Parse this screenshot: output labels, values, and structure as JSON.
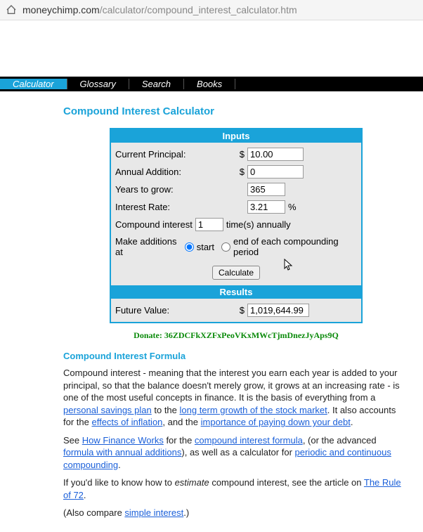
{
  "url": {
    "domain": "moneychimp.com",
    "path": "/calculator/compound_interest_calculator.htm"
  },
  "nav": {
    "items": [
      "Calculator",
      "Glossary",
      "Search",
      "Books"
    ]
  },
  "page": {
    "title": "Compound Interest Calculator",
    "inputs_header": "Inputs",
    "results_header": "Results",
    "labels": {
      "principal": "Current Principal:",
      "addition": "Annual Addition:",
      "years": "Years to grow:",
      "rate": "Interest Rate:",
      "compound_prefix": "Compound interest",
      "compound_suffix": "time(s) annually",
      "additions_at": "Make additions at",
      "start": "start",
      "end": "end of each compounding period",
      "calculate": "Calculate",
      "future_value": "Future Value:",
      "percent": "%",
      "dollar": "$"
    },
    "values": {
      "principal": "10.00",
      "addition": "0",
      "years": "365",
      "rate": "3.21",
      "times": "1",
      "future_value": "1,019,644.99"
    }
  },
  "donate": "Donate: 36ZDCFkXZFxPeoVKxMWcTjmDnezJyAps9Q",
  "article": {
    "heading": "Compound Interest Formula",
    "p1": "Compound interest - meaning that the interest you earn each year is added to your principal, so that the balance doesn't merely grow, it grows at an increasing rate - is one of the most useful concepts in finance. It is the basis of everything from a ",
    "link1": "personal savings plan",
    "p1b": " to the ",
    "link2": "long term growth of the stock market",
    "p1c": ". It also accounts for the ",
    "link3": "effects of inflation",
    "p1d": ", and the ",
    "link4": "importance of paying down your debt",
    "p1e": ".",
    "p2a": "See ",
    "link5": "How Finance Works",
    "p2b": " for the ",
    "link6": "compound interest formula",
    "p2c": ", (or the advanced ",
    "link7": "formula with annual additions",
    "p2d": "), as well as a calculator for ",
    "link8": "periodic and continuous compounding",
    "p2e": ".",
    "p3a": "If you'd like to know how to ",
    "p3_em": "estimate",
    "p3b": " compound interest, see the article on ",
    "link9": "The Rule of 72",
    "p3c": ".",
    "p4a": "(Also compare ",
    "link10": "simple interest",
    "p4b": ".)"
  }
}
